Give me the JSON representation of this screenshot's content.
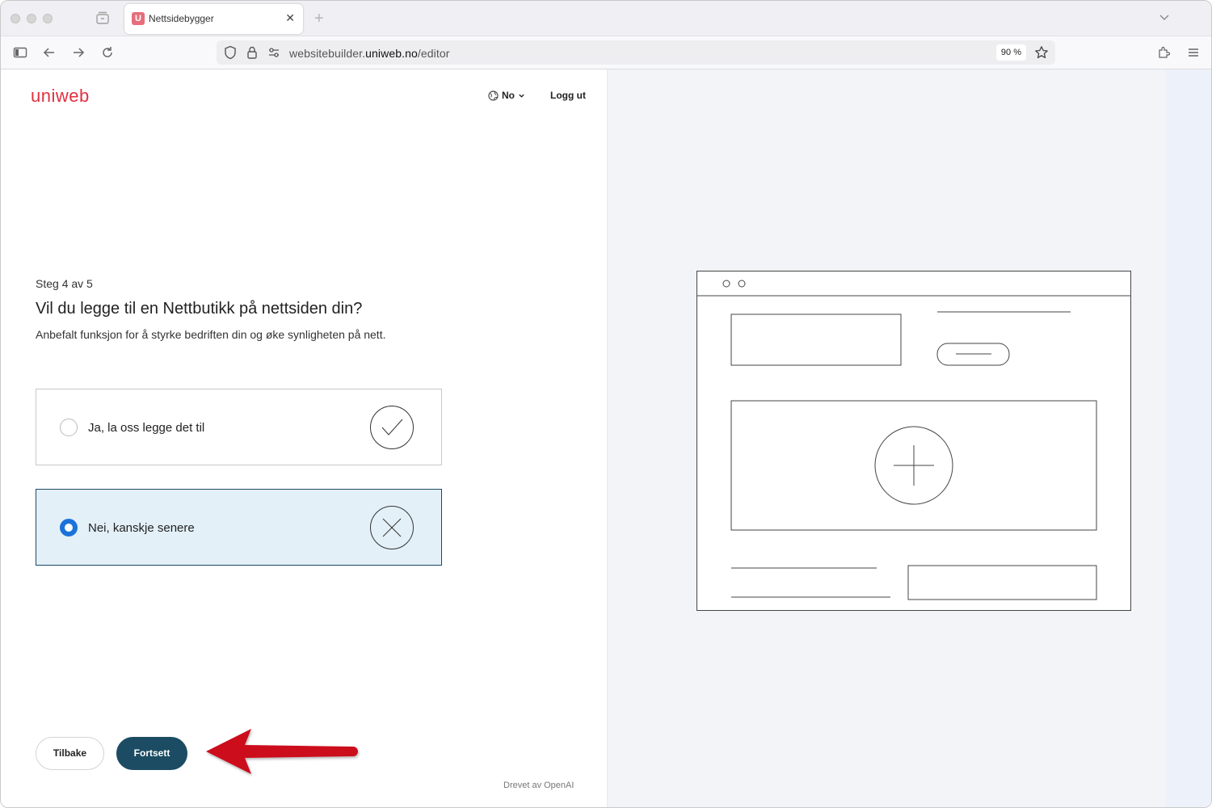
{
  "browser": {
    "tab_title": "Nettsidebygger",
    "tab_favicon": "U",
    "url_host_prefix": "websitebuilder.",
    "url_host_domain": "uniweb.no",
    "url_path": "/editor",
    "zoom": "90 %"
  },
  "header": {
    "logo": "uniweb",
    "language": "No",
    "logout": "Logg ut"
  },
  "wizard": {
    "step": "Steg 4 av 5",
    "question": "Vil du legge til en Nettbutikk på nettsiden din?",
    "hint": "Anbefalt funksjon for å styrke bedriften din og øke synligheten på nett.",
    "options": [
      {
        "label": "Ja, la oss legge det til",
        "icon": "check-circle-icon",
        "selected": false
      },
      {
        "label": "Nei, kanskje senere",
        "icon": "x-circle-icon",
        "selected": true
      }
    ],
    "back_label": "Tilbake",
    "next_label": "Fortsett"
  },
  "footer": {
    "powered_by": "Drevet av OpenAI"
  },
  "colors": {
    "brand": "#e0303f",
    "primary_button": "#1b4c63",
    "selected_bg": "#e3f0f8",
    "radio_selected": "#1a73d9",
    "annotation_arrow": "#cc0a1c"
  }
}
